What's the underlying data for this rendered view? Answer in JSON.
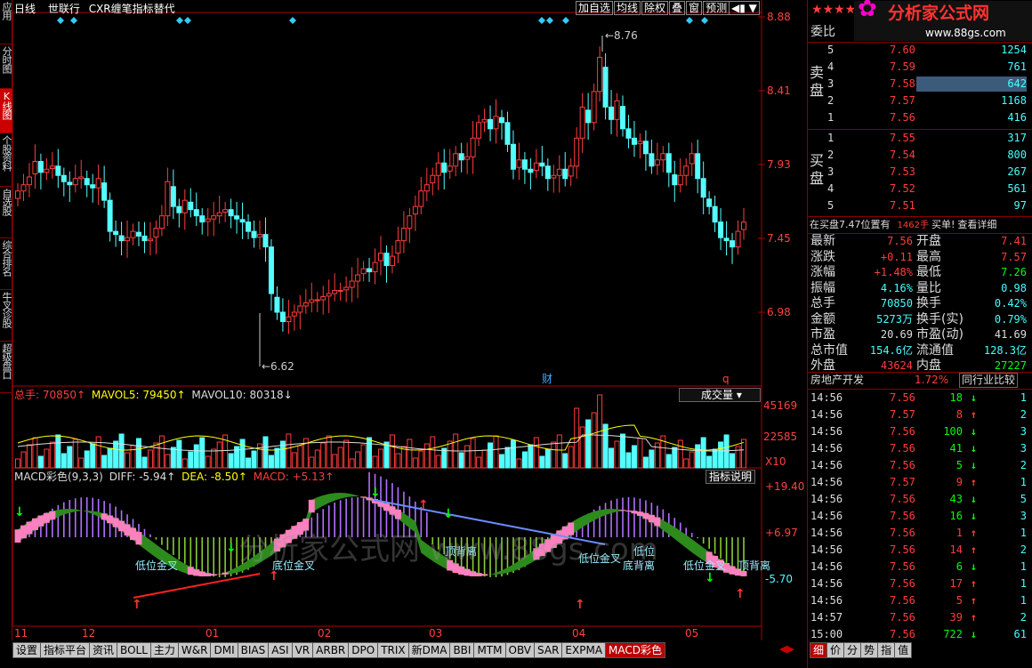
{
  "title": {
    "period": "日线",
    "name": "世联行",
    "indicator": "CXR缠笔指标替代"
  },
  "toolbar": [
    "加自选",
    "均线",
    "除权",
    "叠",
    "窗",
    "预测"
  ],
  "left_tabs": [
    "应用",
    "分时图",
    "K线图",
    "个股资料",
    "自选股",
    "综合排名",
    "牛叉诊股",
    "超级盘口"
  ],
  "price_axis": [
    "8.88",
    "8.41",
    "7.93",
    "7.45",
    "6.98"
  ],
  "annot": {
    "high": "8.76",
    "low": "6.62",
    "cai": "财",
    "q": "q"
  },
  "vol": {
    "label": "总手: 70850↑",
    "ma5": "MAVOL5: 79450↑",
    "ma10": "MAVOL10: 80318↓",
    "dropdown": "成交量",
    "ticks": [
      "45169",
      "22585",
      "X10"
    ]
  },
  "macd": {
    "label": "MACD彩色(9,3,3)",
    "diff": "DIFF: -5.94↑",
    "dea": "DEA: -8.50↑",
    "macd": "MACD: +5.13↑",
    "help": "指标说明",
    "ticks": [
      "+19.40",
      "+6.97",
      "-5.70"
    ],
    "tags": [
      "低位金叉",
      "底位金叉",
      "顶背离",
      "底背离",
      "低位金叉",
      "顶背离",
      "低位金叉",
      "低位"
    ]
  },
  "watermark": "分析家公式网 www.88gs.com",
  "date_axis": [
    "11",
    "12",
    "01",
    "02",
    "03",
    "04",
    "05"
  ],
  "bottom_tabs": [
    "设置",
    "指标平台",
    "资讯",
    "BOLL",
    "主力",
    "W&R",
    "DMI",
    "BIAS",
    "ASI",
    "VR",
    "ARBR",
    "DPO",
    "TRIX",
    "新DMA",
    "BBI",
    "MTM",
    "OBV",
    "SAR",
    "EXPMA",
    "MACD彩色"
  ],
  "right": {
    "logo": "分析家公式网",
    "logo_url": "www.88gs.com",
    "weibi": "委比",
    "sell_label": "卖盘",
    "buy_label": "买盘",
    "sells": [
      [
        "5",
        "7.60",
        "1254"
      ],
      [
        "4",
        "7.59",
        "761"
      ],
      [
        "3",
        "7.58",
        "642"
      ],
      [
        "2",
        "7.57",
        "1168"
      ],
      [
        "1",
        "7.56",
        "416"
      ]
    ],
    "buys": [
      [
        "1",
        "7.55",
        "317"
      ],
      [
        "2",
        "7.54",
        "800"
      ],
      [
        "3",
        "7.53",
        "267"
      ],
      [
        "4",
        "7.52",
        "561"
      ],
      [
        "5",
        "7.51",
        "97"
      ]
    ],
    "zaimai": "在买盘7.47位置有",
    "zaimai_qty": "1462手",
    "zaimai_act": "买单!",
    "detail": "查看详细",
    "stats": [
      [
        "最新",
        "7.56",
        "开盘",
        "7.41"
      ],
      [
        "涨跌",
        "+0.11",
        "最高",
        "7.57"
      ],
      [
        "涨幅",
        "+1.48%",
        "最低",
        "7.26"
      ],
      [
        "振幅",
        "4.16%",
        "量比",
        "0.98"
      ],
      [
        "总手",
        "70850",
        "换手",
        "0.42%"
      ],
      [
        "金额",
        "5273万",
        "换手(实)",
        "0.79%"
      ],
      [
        "市盈",
        "20.69",
        "市盈(动)",
        "41.69"
      ],
      [
        "总市值",
        "154.6亿",
        "流通值",
        "128.3亿"
      ],
      [
        "外盘",
        "43624",
        "内盘",
        "27227"
      ]
    ],
    "sector": "房地产开发",
    "sector_pct": "1.72%",
    "compare": "同行业比较",
    "ticks": [
      [
        "14:56",
        "7.56",
        "18",
        "↓",
        "1"
      ],
      [
        "14:56",
        "7.57",
        "8",
        "↑",
        "2"
      ],
      [
        "14:56",
        "7.56",
        "100",
        "↓",
        "3"
      ],
      [
        "14:56",
        "7.56",
        "41",
        "↓",
        "3"
      ],
      [
        "14:56",
        "7.56",
        "5",
        "↓",
        "2"
      ],
      [
        "14:56",
        "7.57",
        "9",
        "↑",
        "1"
      ],
      [
        "14:56",
        "7.56",
        "43",
        "↓",
        "5"
      ],
      [
        "14:56",
        "7.56",
        "16",
        "↓",
        "3"
      ],
      [
        "14:56",
        "7.56",
        "1",
        "↑",
        "1"
      ],
      [
        "14:56",
        "7.56",
        "14",
        "↑",
        "2"
      ],
      [
        "14:56",
        "7.56",
        "6",
        "↓",
        "1"
      ],
      [
        "14:56",
        "7.56",
        "17",
        "↑",
        "1"
      ],
      [
        "14:56",
        "7.56",
        "5",
        "↑",
        "1"
      ],
      [
        "14:57",
        "7.56",
        "39",
        "↑",
        "2"
      ],
      [
        "15:00",
        "7.56",
        "722",
        "↓",
        "61"
      ]
    ],
    "bottom_tabs": [
      "细",
      "价",
      "分",
      "势",
      "指",
      "值"
    ]
  }
}
